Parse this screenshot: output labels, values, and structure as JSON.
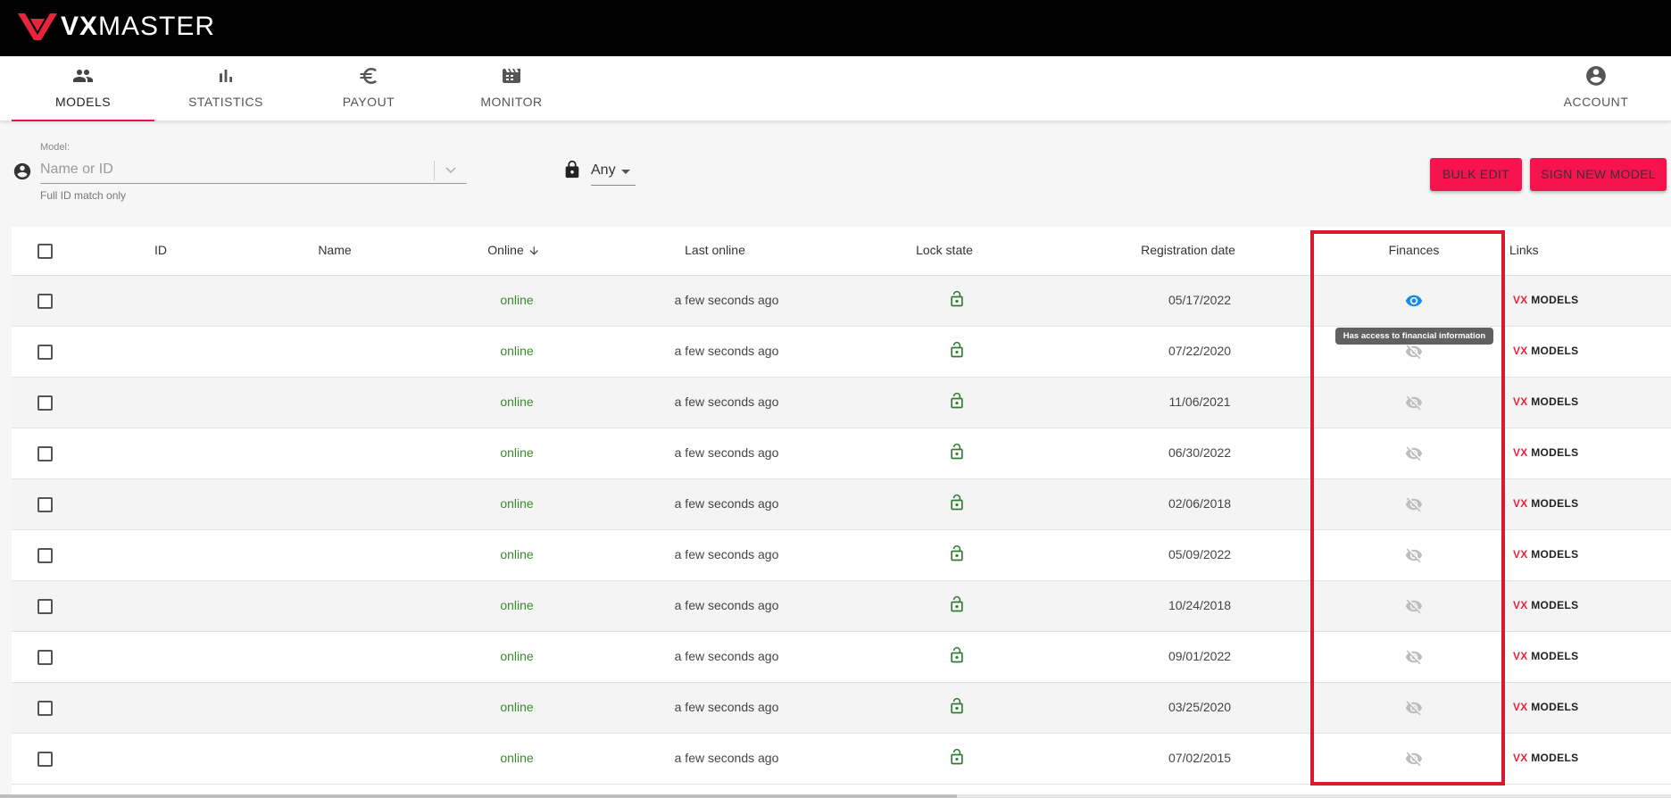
{
  "app": {
    "logo_bold": "VX",
    "logo_light": "MASTER"
  },
  "nav": {
    "items": [
      {
        "label": "MODELS",
        "icon": "people-icon",
        "active": true
      },
      {
        "label": "STATISTICS",
        "icon": "bar-chart-icon"
      },
      {
        "label": "PAYOUT",
        "icon": "euro-icon"
      },
      {
        "label": "MONITOR",
        "icon": "monitor-icon"
      }
    ],
    "account": {
      "label": "ACCOUNT",
      "icon": "account-circle-icon"
    }
  },
  "filter": {
    "model_caption": "Model:",
    "model_placeholder": "Name or ID",
    "model_hint": "Full ID match only",
    "lock_value": "Any"
  },
  "actions": {
    "bulk_edit": "BULK EDIT",
    "sign_new_model": "SIGN NEW MODEL"
  },
  "table": {
    "headers": {
      "id": "ID",
      "name": "Name",
      "online": "Online",
      "last_online": "Last online",
      "lock_state": "Lock state",
      "registration_date": "Registration date",
      "finances": "Finances",
      "links": "Links"
    },
    "sort": {
      "column": "online",
      "direction": "descending"
    },
    "rows": [
      {
        "id": "",
        "name": "",
        "online": "online",
        "last_online": "a few seconds ago",
        "lock": "unlocked",
        "registration_date": "05/17/2022",
        "finances": "visible",
        "link_vx": "VX",
        "link_models": "MODELS"
      },
      {
        "id": "",
        "name": "",
        "online": "online",
        "last_online": "a few seconds ago",
        "lock": "unlocked",
        "registration_date": "07/22/2020",
        "finances": "hidden",
        "link_vx": "VX",
        "link_models": "MODELS"
      },
      {
        "id": "",
        "name": "",
        "online": "online",
        "last_online": "a few seconds ago",
        "lock": "unlocked",
        "registration_date": "11/06/2021",
        "finances": "hidden",
        "link_vx": "VX",
        "link_models": "MODELS"
      },
      {
        "id": "",
        "name": "",
        "online": "online",
        "last_online": "a few seconds ago",
        "lock": "unlocked",
        "registration_date": "06/30/2022",
        "finances": "hidden",
        "link_vx": "VX",
        "link_models": "MODELS"
      },
      {
        "id": "",
        "name": "",
        "online": "online",
        "last_online": "a few seconds ago",
        "lock": "unlocked",
        "registration_date": "02/06/2018",
        "finances": "hidden",
        "link_vx": "VX",
        "link_models": "MODELS"
      },
      {
        "id": "",
        "name": "",
        "online": "online",
        "last_online": "a few seconds ago",
        "lock": "unlocked",
        "registration_date": "05/09/2022",
        "finances": "hidden",
        "link_vx": "VX",
        "link_models": "MODELS"
      },
      {
        "id": "",
        "name": "",
        "online": "online",
        "last_online": "a few seconds ago",
        "lock": "unlocked",
        "registration_date": "10/24/2018",
        "finances": "hidden",
        "link_vx": "VX",
        "link_models": "MODELS"
      },
      {
        "id": "",
        "name": "",
        "online": "online",
        "last_online": "a few seconds ago",
        "lock": "unlocked",
        "registration_date": "09/01/2022",
        "finances": "hidden",
        "link_vx": "VX",
        "link_models": "MODELS"
      },
      {
        "id": "",
        "name": "",
        "online": "online",
        "last_online": "a few seconds ago",
        "lock": "unlocked",
        "registration_date": "03/25/2020",
        "finances": "hidden",
        "link_vx": "VX",
        "link_models": "MODELS"
      },
      {
        "id": "",
        "name": "",
        "online": "online",
        "last_online": "a few seconds ago",
        "lock": "unlocked",
        "registration_date": "07/02/2015",
        "finances": "hidden",
        "link_vx": "VX",
        "link_models": "MODELS"
      }
    ],
    "tooltip": "Has access to financial information"
  },
  "colors": {
    "brand": "#f7134e",
    "online_text": "#3c8a2e",
    "lock_icon": "#2e7d32",
    "eye_active": "#1e88e5",
    "eye_inactive": "#bdbdbd",
    "highlight": "#d9192d"
  }
}
